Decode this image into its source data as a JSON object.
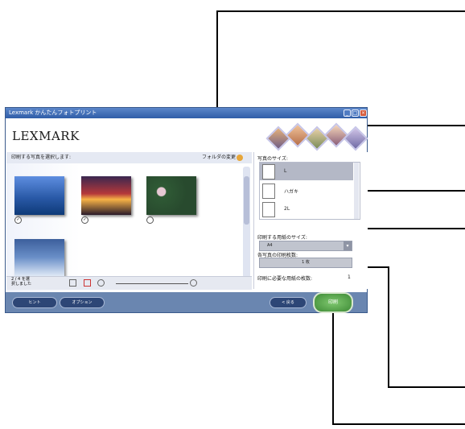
{
  "window": {
    "title": "Lexmark かんたんフォトプリント",
    "logo": "LEXMARK"
  },
  "photo_area": {
    "instruction": "印刷する写真を選択します:",
    "folder_change": "フォルダの変更",
    "selection_count": "2 / 4 を選\n択しました"
  },
  "right_panel": {
    "photo_size_label": "写真のサイズ:",
    "photo_sizes": [
      "L",
      "ハガキ",
      "2L"
    ],
    "paper_size_label": "印刷する用紙のサイズ:",
    "paper_size_value": "A4",
    "copies_label": "各写真の印刷枚数:",
    "copies_value": "1 枚",
    "sheets_label": "印刷に必要な用紙の枚数:",
    "sheets_value": "1"
  },
  "footer": {
    "hint": "ヒント",
    "options": "オプション",
    "back": "< 戻る",
    "print": "印刷"
  },
  "colors": {
    "title_bar": "#2f5da8",
    "footer": "#6a86b0",
    "print_button": "#3d8a35"
  }
}
